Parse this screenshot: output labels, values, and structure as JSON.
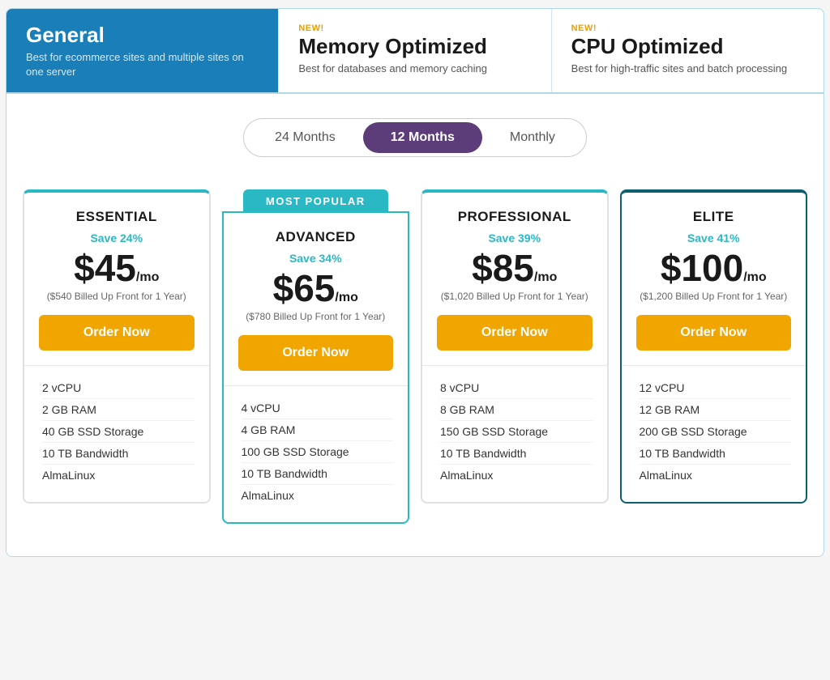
{
  "tabs": [
    {
      "id": "general",
      "new": false,
      "title": "General",
      "desc": "Best for ecommerce sites and multiple sites on one server",
      "active": true
    },
    {
      "id": "memory",
      "new": true,
      "title": "Memory Optimized",
      "desc": "Best for databases and memory caching",
      "active": false
    },
    {
      "id": "cpu",
      "new": true,
      "title": "CPU Optimized",
      "desc": "Best for high-traffic sites and batch processing",
      "active": false
    }
  ],
  "billing": {
    "options": [
      "24 Months",
      "12 Months",
      "Monthly"
    ],
    "active": "12 Months"
  },
  "most_popular_label": "MOST POPULAR",
  "order_button_label": "Order Now",
  "plans": [
    {
      "id": "essential",
      "name": "ESSENTIAL",
      "save": "Save 24%",
      "price": "$45",
      "per": "/mo",
      "billed": "($540 Billed Up Front for 1 Year)",
      "popular": false,
      "elite": false,
      "features": [
        "2 vCPU",
        "2 GB RAM",
        "40 GB SSD Storage",
        "10 TB Bandwidth",
        "AlmaLinux"
      ]
    },
    {
      "id": "advanced",
      "name": "ADVANCED",
      "save": "Save 34%",
      "price": "$65",
      "per": "/mo",
      "billed": "($780 Billed Up Front for 1 Year)",
      "popular": true,
      "elite": false,
      "features": [
        "4 vCPU",
        "4 GB RAM",
        "100 GB SSD Storage",
        "10 TB Bandwidth",
        "AlmaLinux"
      ]
    },
    {
      "id": "professional",
      "name": "PROFESSIONAL",
      "save": "Save 39%",
      "price": "$85",
      "per": "/mo",
      "billed": "($1,020 Billed Up Front for 1 Year)",
      "popular": false,
      "elite": false,
      "features": [
        "8 vCPU",
        "8 GB RAM",
        "150 GB SSD Storage",
        "10 TB Bandwidth",
        "AlmaLinux"
      ]
    },
    {
      "id": "elite",
      "name": "ELITE",
      "save": "Save 41%",
      "price": "$100",
      "per": "/mo",
      "billed": "($1,200 Billed Up Front for 1 Year)",
      "popular": false,
      "elite": true,
      "features": [
        "12 vCPU",
        "12 GB RAM",
        "200 GB SSD Storage",
        "10 TB Bandwidth",
        "AlmaLinux"
      ]
    }
  ]
}
